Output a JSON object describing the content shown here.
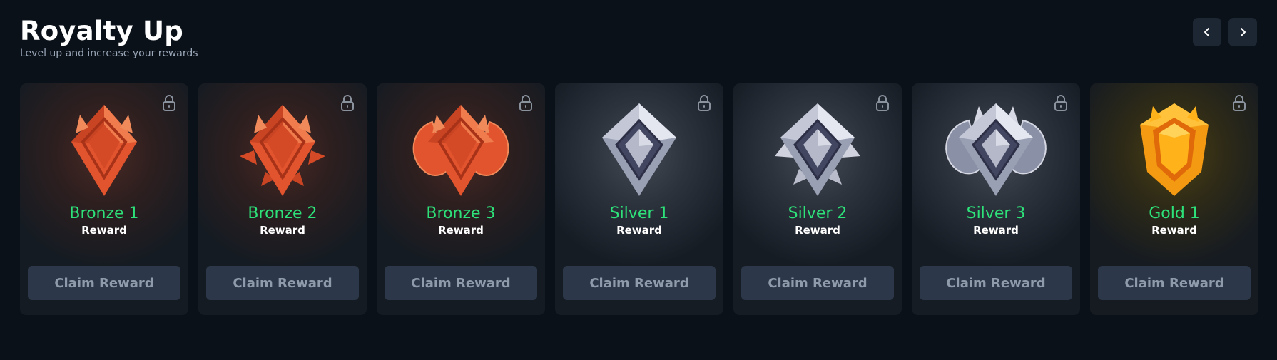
{
  "header": {
    "title": "Royalty Up",
    "subtitle": "Level up and increase your rewards"
  },
  "nav": {
    "prev_icon": "chevron-left-icon",
    "next_icon": "chevron-right-icon"
  },
  "cards": [
    {
      "tier": "Bronze 1",
      "reward_label": "Reward",
      "claim_label": "Claim Reward",
      "rank": "bronze",
      "icon": "bronze-1-badge-icon"
    },
    {
      "tier": "Bronze 2",
      "reward_label": "Reward",
      "claim_label": "Claim Reward",
      "rank": "bronze",
      "icon": "bronze-2-badge-icon"
    },
    {
      "tier": "Bronze 3",
      "reward_label": "Reward",
      "claim_label": "Claim Reward",
      "rank": "bronze",
      "icon": "bronze-3-badge-icon"
    },
    {
      "tier": "Silver 1",
      "reward_label": "Reward",
      "claim_label": "Claim Reward",
      "rank": "silver",
      "icon": "silver-1-badge-icon"
    },
    {
      "tier": "Silver 2",
      "reward_label": "Reward",
      "claim_label": "Claim Reward",
      "rank": "silver",
      "icon": "silver-2-badge-icon"
    },
    {
      "tier": "Silver 3",
      "reward_label": "Reward",
      "claim_label": "Claim Reward",
      "rank": "silver",
      "icon": "silver-3-badge-icon"
    },
    {
      "tier": "Gold 1",
      "reward_label": "Reward",
      "claim_label": "Claim Reward",
      "rank": "gold",
      "icon": "gold-1-badge-icon"
    }
  ],
  "colors": {
    "background": "#0b1119",
    "tier_text": "#2ee27a",
    "button_bg": "#2c3849",
    "button_text": "#8f9aab"
  }
}
